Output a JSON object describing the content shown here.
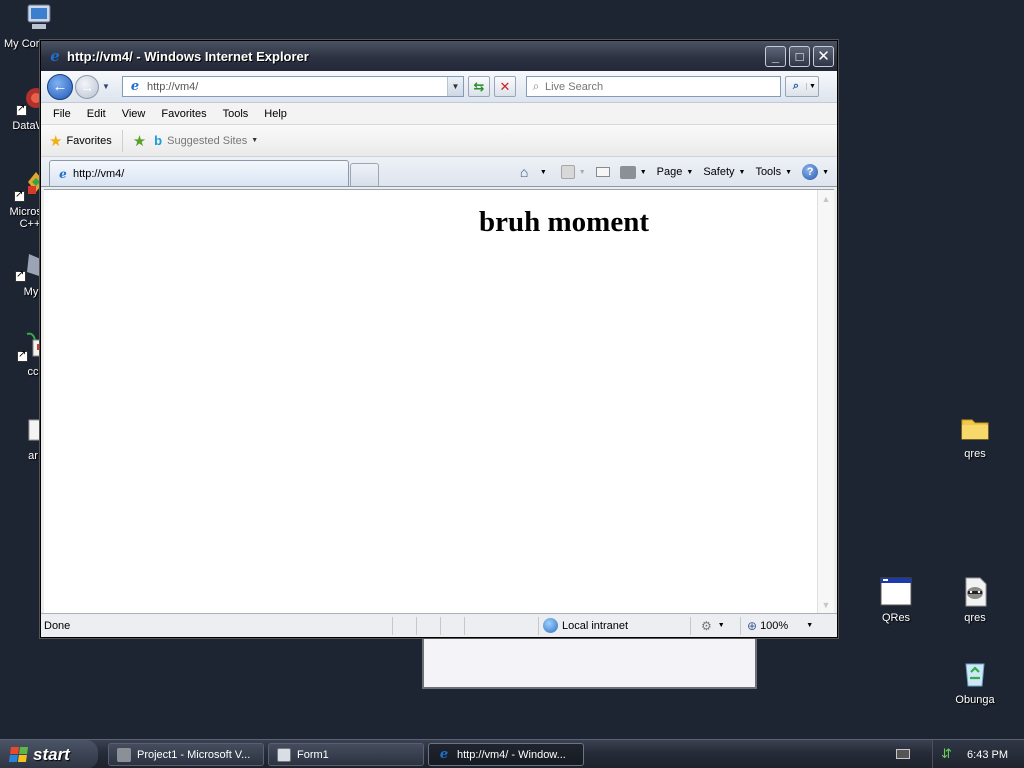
{
  "desktop": {
    "icons_left": [
      {
        "label": "My Cor"
      },
      {
        "label": "DataWa"
      },
      {
        "label": "Microsol",
        "label2": "C++"
      },
      {
        "label": "My"
      },
      {
        "label": "cc"
      },
      {
        "label": "ar"
      }
    ],
    "icons_right": [
      {
        "label": "qres"
      },
      {
        "label": "QRes"
      },
      {
        "label": "qres"
      },
      {
        "label": "Obunga"
      }
    ]
  },
  "window": {
    "title": "http://vm4/ - Windows Internet Explorer",
    "address": "http://vm4/",
    "search_placeholder": "Live Search",
    "menu": [
      "File",
      "Edit",
      "View",
      "Favorites",
      "Tools",
      "Help"
    ],
    "favorites_label": "Favorites",
    "suggested_sites_label": "Suggested Sites",
    "tab_label": "http://vm4/",
    "commands": {
      "page": "Page",
      "safety": "Safety",
      "tools": "Tools"
    },
    "page_heading": "bruh moment",
    "status": {
      "text": "Done",
      "zone": "Local intranet",
      "zoom": "100%"
    }
  },
  "taskbar": {
    "start_label": "start",
    "tasks": [
      {
        "label": "Project1 - Microsoft V..."
      },
      {
        "label": "Form1"
      },
      {
        "label": "http://vm4/ - Window..."
      }
    ],
    "clock": "6:43 PM"
  },
  "colors": {
    "desktop_bg": "#1d2432",
    "titlebar": "#2c3240",
    "ie_blue": "#1f6fd0"
  }
}
